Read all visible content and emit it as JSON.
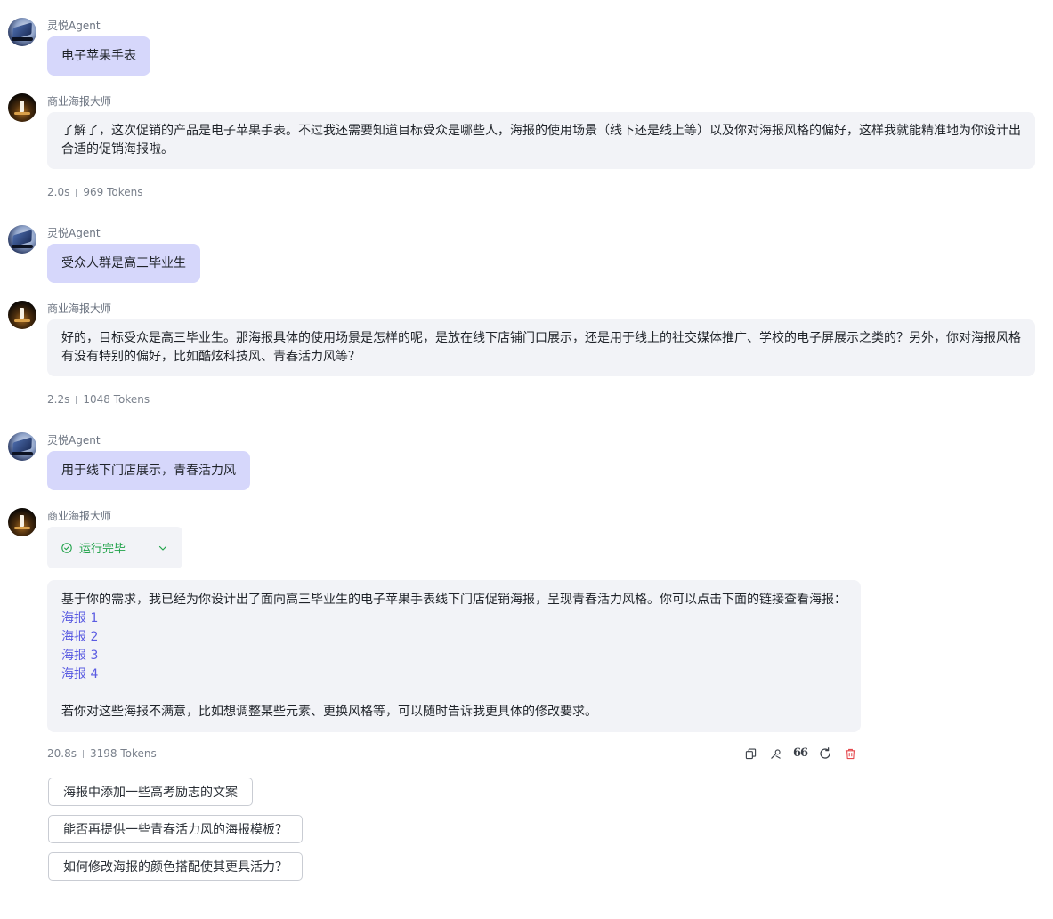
{
  "messages": [
    {
      "role": "user",
      "sender": "灵悦Agent",
      "text": "电子苹果手表"
    },
    {
      "role": "bot",
      "sender": "商业海报大师",
      "text": "了解了，这次促销的产品是电子苹果手表。不过我还需要知道目标受众是哪些人，海报的使用场景（线下还是线上等）以及你对海报风格的偏好，这样我就能精准地为你设计出合适的促销海报啦。",
      "time": "2.0s",
      "tokens": "969 Tokens"
    },
    {
      "role": "user",
      "sender": "灵悦Agent",
      "text": "受众人群是高三毕业生"
    },
    {
      "role": "bot",
      "sender": "商业海报大师",
      "text": "好的，目标受众是高三毕业生。那海报具体的使用场景是怎样的呢，是放在线下店铺门口展示，还是用于线上的社交媒体推广、学校的电子屏展示之类的？另外，你对海报风格有没有特别的偏好，比如酷炫科技风、青春活力风等？",
      "time": "2.2s",
      "tokens": "1048 Tokens"
    },
    {
      "role": "user",
      "sender": "灵悦Agent",
      "text": "用于线下门店展示，青春活力风"
    },
    {
      "role": "bot",
      "sender": "商业海报大师"
    }
  ],
  "final": {
    "status_label": "运行完毕",
    "intro": "基于你的需求，我已经为你设计出了面向高三毕业生的电子苹果手表线下门店促销海报，呈现青春活力风格。你可以点击下面的链接查看海报：",
    "links": [
      "海报 1",
      "海报 2",
      "海报 3",
      "海报 4"
    ],
    "outro": "若你对这些海报不满意，比如想调整某些元素、更换风格等，可以随时告诉我更具体的修改要求。",
    "time": "20.8s",
    "tokens": "3198 Tokens"
  },
  "actions": {
    "icons": [
      "copy-icon",
      "wrench-icon",
      "quote-icon",
      "refresh-icon",
      "delete-icon"
    ],
    "quote_glyph": "66",
    "delete_color": "#e5484d"
  },
  "suggestions": [
    "海报中添加一些高考励志的文案",
    "能否再提供一些青春活力风的海报模板？",
    "如何修改海报的颜色搭配使其更具活力？"
  ],
  "colors": {
    "user_bubble": "#d6d7fb",
    "bot_bubble": "#f2f3f7",
    "link": "#5b5ce2",
    "status_ok": "#22a34b"
  }
}
